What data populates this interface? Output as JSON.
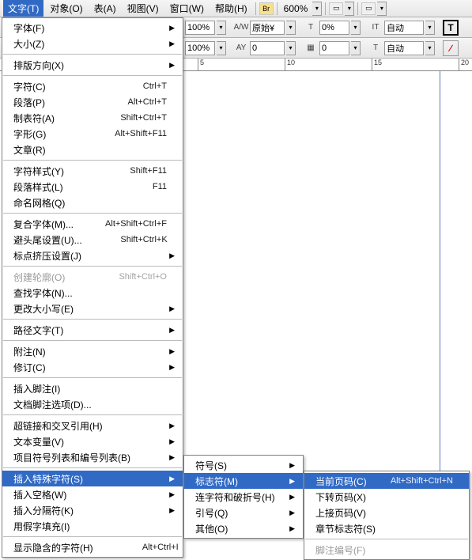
{
  "menubar": {
    "items": [
      "文字(T)",
      "对象(O)",
      "表(A)",
      "视图(V)",
      "窗口(W)",
      "帮助(H)"
    ],
    "br_label": "Br",
    "zoom": "600%"
  },
  "toolbar": {
    "pct1": "100%",
    "pct2": "100%",
    "aw_label": "A/W",
    "orig_label": "原始¥",
    "t_label": "T",
    "zero1": "0%",
    "zero2": "0",
    "it": "IT",
    "ay": "AY",
    "auto": "自动",
    "tbig": "T"
  },
  "ruler": {
    "t5": "5",
    "t10": "10",
    "t15": "15",
    "t20": "20"
  },
  "menu_main": [
    {
      "label": "字体(F)",
      "sub": true
    },
    {
      "label": "大小(Z)",
      "sub": true
    },
    {
      "sep": true
    },
    {
      "label": "排版方向(X)",
      "sub": true
    },
    {
      "sep": true
    },
    {
      "label": "字符(C)",
      "sc": "Ctrl+T"
    },
    {
      "label": "段落(P)",
      "sc": "Alt+Ctrl+T"
    },
    {
      "label": "制表符(A)",
      "sc": "Shift+Ctrl+T"
    },
    {
      "label": "字形(G)",
      "sc": "Alt+Shift+F11"
    },
    {
      "label": "文章(R)"
    },
    {
      "sep": true
    },
    {
      "label": "字符样式(Y)",
      "sc": "Shift+F11"
    },
    {
      "label": "段落样式(L)",
      "sc": "F11"
    },
    {
      "label": "命名网格(Q)"
    },
    {
      "sep": true
    },
    {
      "label": "复合字体(M)...",
      "sc": "Alt+Shift+Ctrl+F"
    },
    {
      "label": "避头尾设置(U)...",
      "sc": "Shift+Ctrl+K"
    },
    {
      "label": "标点挤压设置(J)",
      "sub": true
    },
    {
      "sep": true
    },
    {
      "label": "创建轮廓(O)",
      "sc": "Shift+Ctrl+O",
      "disabled": true
    },
    {
      "label": "查找字体(N)..."
    },
    {
      "label": "更改大小写(E)",
      "sub": true
    },
    {
      "sep": true
    },
    {
      "label": "路径文字(T)",
      "sub": true
    },
    {
      "sep": true
    },
    {
      "label": "附注(N)",
      "sub": true
    },
    {
      "label": "修订(C)",
      "sub": true
    },
    {
      "sep": true
    },
    {
      "label": "插入脚注(I)"
    },
    {
      "label": "文档脚注选项(D)..."
    },
    {
      "sep": true
    },
    {
      "label": "超链接和交叉引用(H)",
      "sub": true
    },
    {
      "label": "文本变量(V)",
      "sub": true
    },
    {
      "label": "项目符号列表和编号列表(B)",
      "sub": true
    },
    {
      "sep": true
    },
    {
      "label": "插入特殊字符(S)",
      "sub": true,
      "sel": true
    },
    {
      "label": "插入空格(W)",
      "sub": true
    },
    {
      "label": "插入分隔符(K)",
      "sub": true
    },
    {
      "label": "用假字填充(I)"
    },
    {
      "sep": true
    },
    {
      "label": "显示隐含的字符(H)",
      "sc": "Alt+Ctrl+I"
    }
  ],
  "menu_sub1": [
    {
      "label": "符号(S)",
      "sub": true
    },
    {
      "label": "标志符(M)",
      "sub": true,
      "sel": true
    },
    {
      "label": "连字符和破折号(H)",
      "sub": true
    },
    {
      "label": "引号(Q)",
      "sub": true
    },
    {
      "label": "其他(O)",
      "sub": true
    }
  ],
  "menu_sub2": [
    {
      "label": "当前页码(C)",
      "sc": "Alt+Shift+Ctrl+N",
      "sel": true
    },
    {
      "label": "下转页码(X)"
    },
    {
      "label": "上接页码(V)"
    },
    {
      "label": "章节标志符(S)"
    },
    {
      "sep": true
    },
    {
      "label": "脚注编号(F)",
      "disabled": true
    }
  ]
}
